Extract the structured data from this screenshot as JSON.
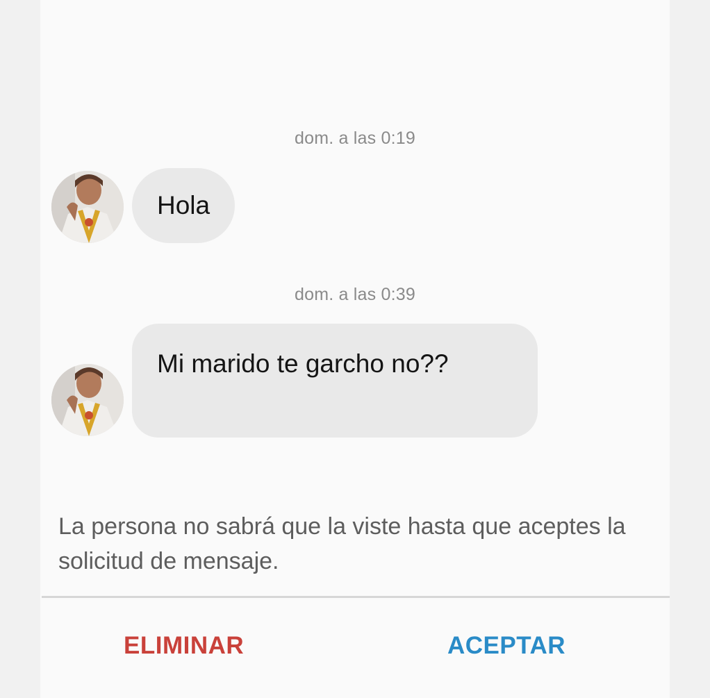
{
  "conversation": {
    "messages": [
      {
        "timestamp": "dom. a las 0:19",
        "text": "Hola"
      },
      {
        "timestamp": "dom. a las 0:39",
        "text": "Mi marido te garcho no??"
      }
    ]
  },
  "request_notice": "La persona no sabrá que la viste hasta que aceptes la solicitud de mensaje.",
  "actions": {
    "delete_label": "ELIMINAR",
    "accept_label": "ACEPTAR"
  },
  "colors": {
    "delete": "#c9413a",
    "accept": "#2a8bc7",
    "bubble": "#e9e9e9",
    "timestamp": "#8a8a8a"
  }
}
